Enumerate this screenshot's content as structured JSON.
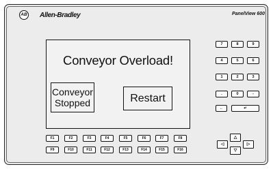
{
  "header": {
    "logo_text": "AB",
    "brand": "Allen-Bradley",
    "model": "PanelView 600"
  },
  "screen": {
    "title": "Conveyor Overload!",
    "status_button": {
      "line1": "Conveyor",
      "line2": "Stopped"
    },
    "restart_label": "Restart"
  },
  "keypad": {
    "row1": [
      "7",
      "8",
      "9"
    ],
    "row2": [
      "4",
      "5",
      "6"
    ],
    "row3": [
      "1",
      "2",
      "3"
    ],
    "row4": [
      ".",
      "0",
      "-"
    ],
    "backspace": "←",
    "enter": "↵"
  },
  "function_keys": {
    "row1": [
      "F1",
      "F2",
      "F3",
      "F4",
      "F5",
      "F6",
      "F7",
      "F8"
    ],
    "row2": [
      "F9",
      "F10",
      "F11",
      "F12",
      "F13",
      "F14",
      "F15",
      "F16"
    ]
  },
  "arrows": {
    "up": "△",
    "down": "▽",
    "left": "◁",
    "right": "▷"
  }
}
